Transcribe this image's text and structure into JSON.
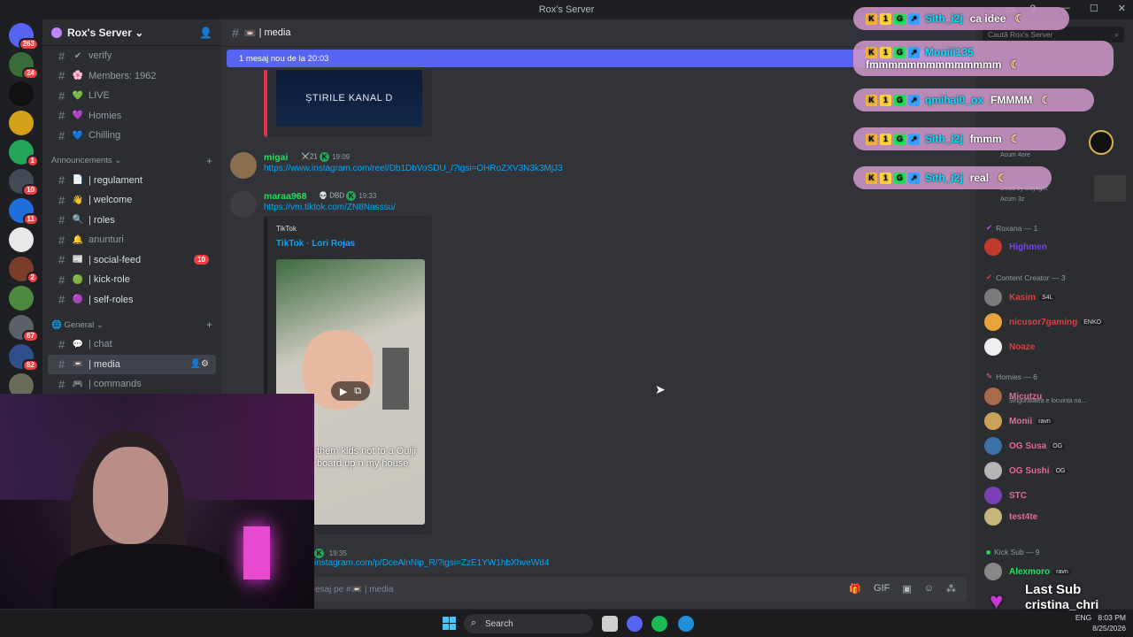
{
  "window": {
    "title": "Rox's Server"
  },
  "rail": {
    "servers": [
      {
        "badge": "263",
        "color": "#5865f2"
      },
      {
        "badge": "24",
        "color": "#3a6b3a"
      },
      {
        "badge": "",
        "color": "#111111"
      },
      {
        "badge": "",
        "color": "#d4a017"
      },
      {
        "badge": "1",
        "color": "#23a55a"
      },
      {
        "badge": "10",
        "color": "#444a55"
      },
      {
        "badge": "11",
        "color": "#1e6fd9"
      },
      {
        "badge": "",
        "color": "#e8e8e8"
      },
      {
        "badge": "2",
        "color": "#7a3d2a"
      },
      {
        "badge": "",
        "color": "#4d8a3e"
      },
      {
        "badge": "67",
        "color": "#5b5f68"
      },
      {
        "badge": "82",
        "color": "#2e4f8a"
      },
      {
        "badge": "",
        "color": "#6b6b5b"
      }
    ]
  },
  "sidebar": {
    "server_name": "Rox's Server",
    "channels_top": [
      {
        "emoji": "✔",
        "name": "verify"
      },
      {
        "emoji": "🌸",
        "name": "Members: 1962"
      },
      {
        "emoji": "💚",
        "name": "LIVE"
      },
      {
        "emoji": "💜",
        "name": "Homies"
      },
      {
        "emoji": "💙",
        "name": "Chilling"
      }
    ],
    "cat_announcements": "Announcements",
    "channels_ann": [
      {
        "emoji": "📄",
        "name": "| regulament",
        "bright": true
      },
      {
        "emoji": "👋",
        "name": "| welcome",
        "bright": true
      },
      {
        "emoji": "🔍",
        "name": "| roles",
        "bright": true
      },
      {
        "emoji": "🔔",
        "name": "anunturi",
        "bright": false
      },
      {
        "emoji": "📰",
        "name": "| social-feed",
        "bright": true,
        "count": "10"
      },
      {
        "emoji": "🟢",
        "name": "| kick-role",
        "bright": true
      },
      {
        "emoji": "🟣",
        "name": "| self-roles",
        "bright": true
      }
    ],
    "cat_general": "General",
    "channels_gen": [
      {
        "emoji": "💬",
        "name": "| chat"
      },
      {
        "emoji": "📼",
        "name": "| media",
        "active": true
      },
      {
        "emoji": "🎮",
        "name": "| commands"
      }
    ]
  },
  "main": {
    "channel": "| media",
    "new_messages_bar": "1 mesaj nou de la 20:03",
    "embed_top_text": "ȘTIRILE KANAL D",
    "messages": [
      {
        "user": "migai",
        "tag": "21",
        "time": "19:09",
        "link": "https://www.instagram.com/reel/Db1DbVoSDU_/?igsi=OHRoZXV3N3k3MjJ3",
        "name_color": "#23e05a"
      },
      {
        "user": "maraa968",
        "tag": "DBD",
        "time": "19:33",
        "link": "https://vm.tiktok.com/ZN8Nasssu/",
        "name_color": "#23e05a"
      }
    ],
    "tiktok": {
      "provider": "TikTok",
      "title": "TikTok · Lori Rojas",
      "caption": "them kids not to a Ouiji board up n my house"
    },
    "last_msg": {
      "time": "19:35",
      "link": "instagram.com/p/DceAlnNip_R/?igsi=ZzE1YW1hbXhveWd4"
    },
    "input_placeholder": "esaj pe #📼 | media"
  },
  "members": {
    "search_placeholder": "Caută Rox's Server",
    "groups": [
      {
        "name": "Roxana — 1"
      },
      {
        "name": "Content Creator — 3"
      },
      {
        "name": "Homies — 6"
      },
      {
        "name": "Kick Sub — 9"
      }
    ],
    "items": [
      {
        "name": "Highmen",
        "tag": "",
        "color": "#7b3ff2",
        "avatar": "#c0392b"
      },
      {
        "name": "Kasim",
        "tag": "S4L",
        "color": "#e03e3e",
        "avatar": "#7a7a7a"
      },
      {
        "name": "nicusor7gaming",
        "tag": "ENKO",
        "color": "#e03e3e",
        "avatar": "#e8a33a"
      },
      {
        "name": "Noaze",
        "tag": "",
        "color": "#e03e3e",
        "avatar": "#eeeeee"
      },
      {
        "name": "Micutzu",
        "tag": "",
        "color": "#e56b9a",
        "avatar": "#a86a4a",
        "status": "Singurătatea e locuința na..."
      },
      {
        "name": "Monii",
        "tag": "ravn",
        "color": "#e56b9a",
        "avatar": "#caa35a"
      },
      {
        "name": "OG Susa",
        "tag": "OG",
        "color": "#e56b9a",
        "avatar": "#3b6fa8"
      },
      {
        "name": "OG Sushi",
        "tag": "OG",
        "color": "#e56b9a",
        "avatar": "#b5b5b5"
      },
      {
        "name": "STC",
        "tag": "",
        "color": "#e56b9a",
        "avatar": "#7a3fb5"
      },
      {
        "name": "test4te",
        "tag": "",
        "color": "#e56b9a",
        "avatar": "#c9b67a"
      },
      {
        "name": "Alexmoro",
        "tag": "ravn",
        "color": "#23e05a",
        "avatar": "#888888"
      }
    ],
    "activity": {
      "a1": "Acum 4ore",
      "a2": "Dead by Daylight",
      "a3": "Acum 3z"
    }
  },
  "overlay": [
    {
      "nick": "Sith_i2j",
      "text": "ca idee"
    },
    {
      "nick": "Moniii135",
      "text": "fmmmmmmmmmmmmmm"
    },
    {
      "nick": "qmihai0_ox",
      "text": "FMMMM"
    },
    {
      "nick": "Sith_i2j",
      "text": "fmmm"
    },
    {
      "nick": "Sith_i2j",
      "text": "real"
    }
  ],
  "stream": {
    "last_sub_label": "Last Sub",
    "last_sub_name": "cristina_chri"
  },
  "taskbar": {
    "search": "Search",
    "lang": "ENG",
    "time": "8:03 PM",
    "date": "8/25/2026"
  }
}
